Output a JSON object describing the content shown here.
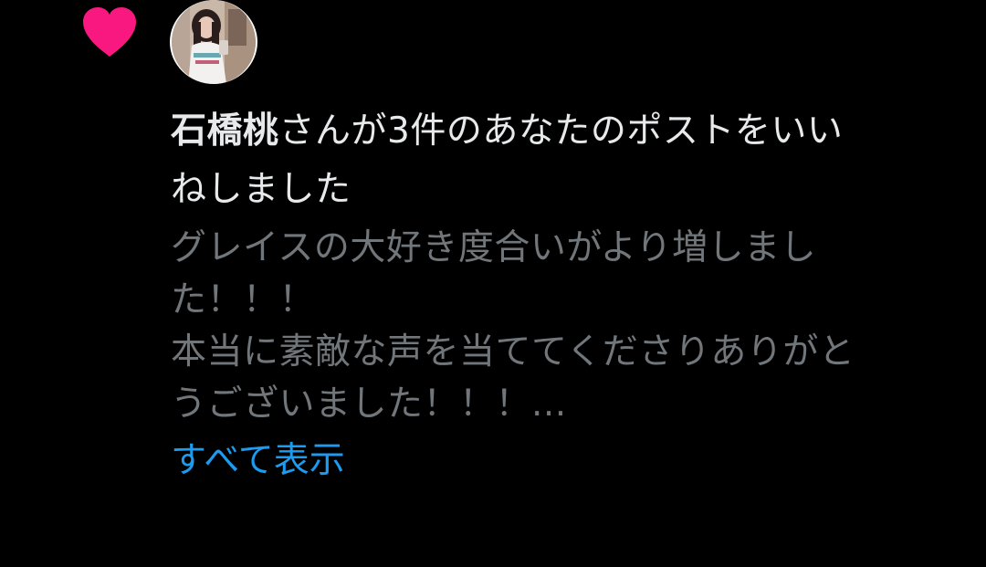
{
  "notification": {
    "type_icon": "heart-icon",
    "heart_color": "#f91880",
    "headline": {
      "name": "石橋桃",
      "line1_rest": "さんが3件のあなたのポストをいい",
      "line2": "ねしました"
    },
    "post_text": {
      "line1": "グレイスの大好き度合いがより増しまし",
      "line2": "た！！！",
      "line3": "本当に素敵な声を当ててくださりありがと",
      "line4": "うございました！！！..."
    },
    "show_all_label": "すべて表示"
  },
  "colors": {
    "background": "#000000",
    "primary_text": "#e7e9ea",
    "secondary_text": "#71767b",
    "link": "#1d9bf0"
  }
}
